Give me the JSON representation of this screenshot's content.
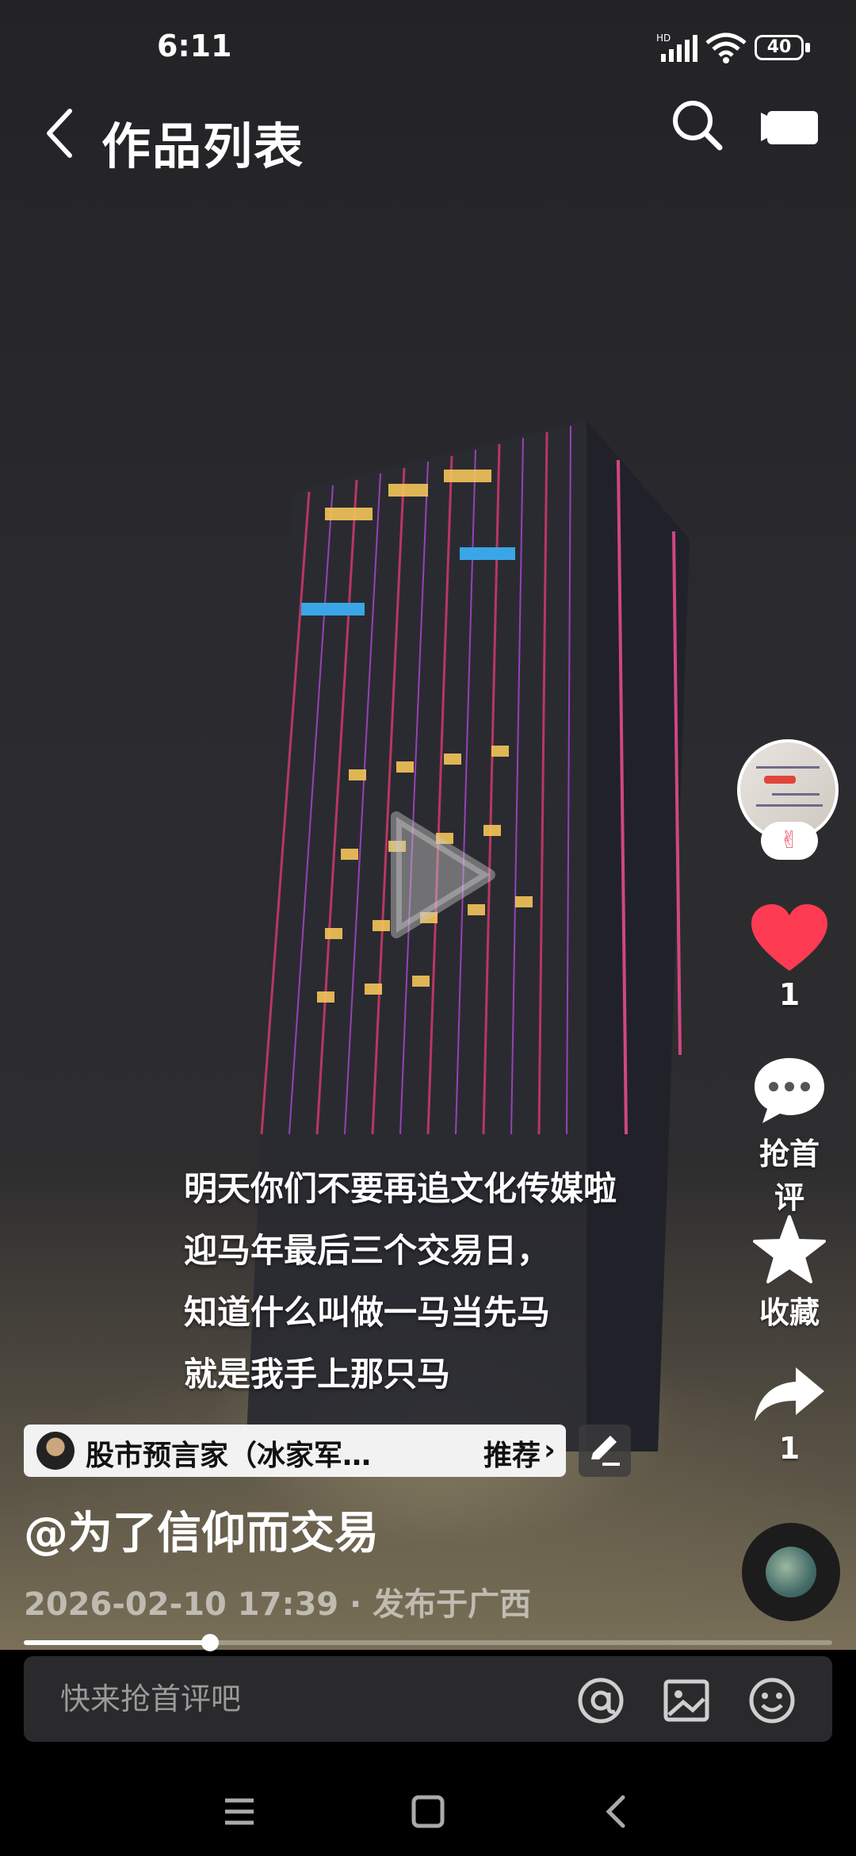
{
  "status_bar": {
    "time": "6:11",
    "network_badge": "HD",
    "battery": "40"
  },
  "nav": {
    "title": "作品列表",
    "icons": [
      "back-icon",
      "search-icon",
      "camera-icon"
    ]
  },
  "caption": [
    "明天你们不要再追文化传媒啦",
    "迎马年最后三个交易日，",
    "知道什么叫做一马当先马",
    "就是我手上那只马"
  ],
  "actions": {
    "like_count": "1",
    "comment_label": "抢首评",
    "favorite_label": "收藏",
    "share_count": "1"
  },
  "author_chip": {
    "name": "股市预言家（冰家军…",
    "recommend": "推荐",
    "arrow": "›"
  },
  "post": {
    "mention": "@为了信仰而交易",
    "meta": "2026-02-10 17:39 · 发布于广西"
  },
  "progress": {
    "fraction": 0.23
  },
  "comment_bar": {
    "placeholder": "快来抢首评吧"
  },
  "colors": {
    "like": "#fd3b53",
    "background": "#1a1a1c"
  }
}
